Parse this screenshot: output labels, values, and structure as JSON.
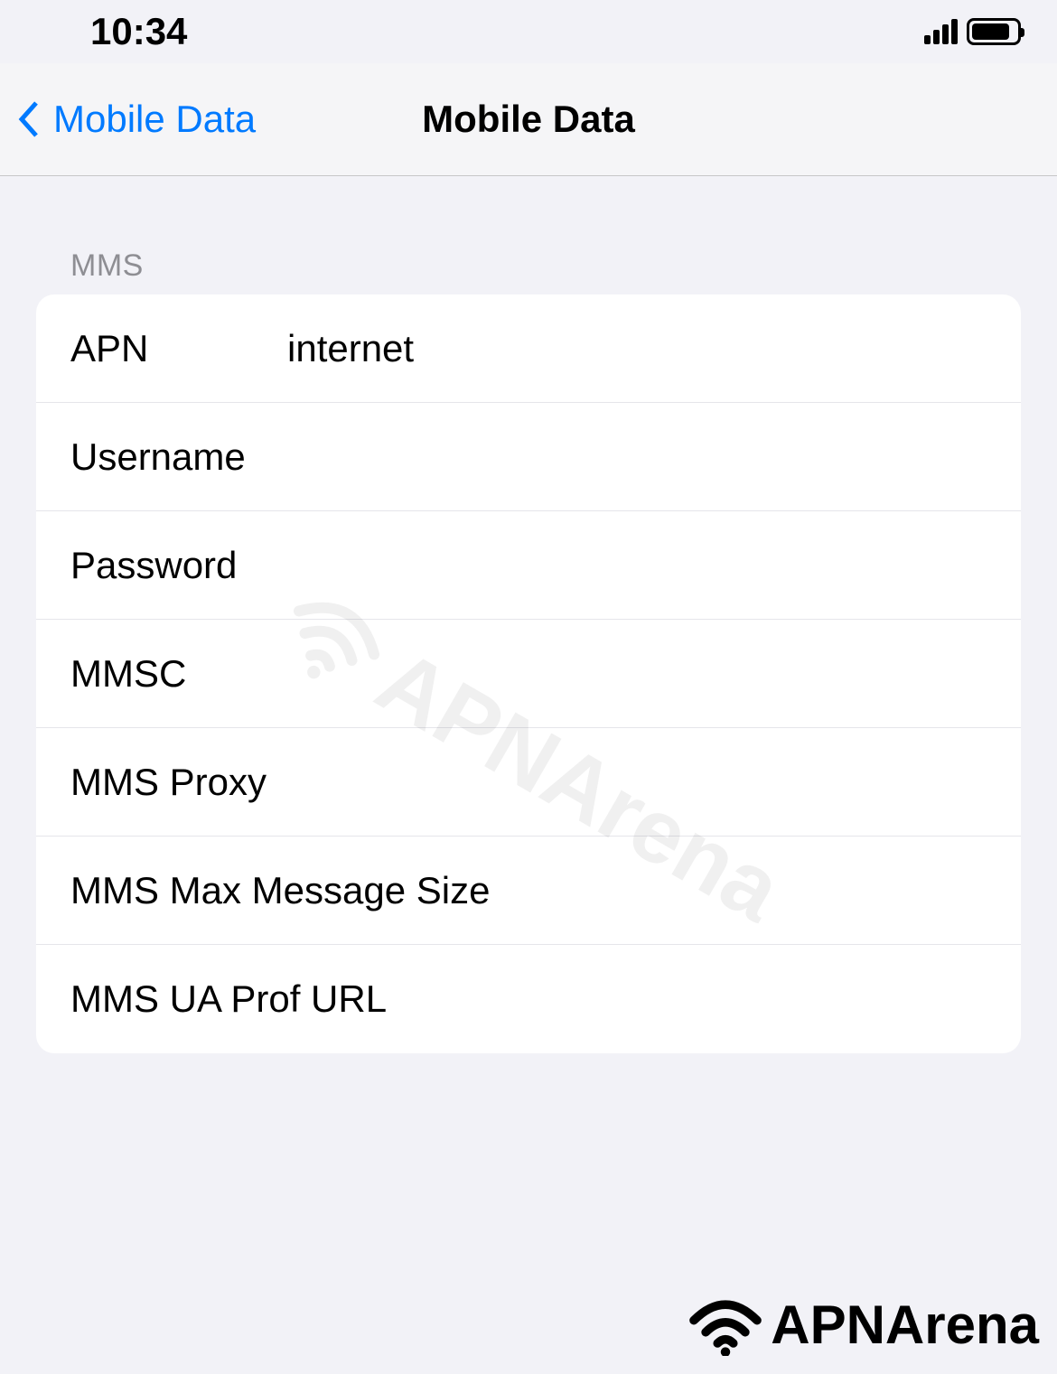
{
  "status_bar": {
    "time": "10:34"
  },
  "nav": {
    "back_label": "Mobile Data",
    "title": "Mobile Data"
  },
  "section": {
    "header": "MMS",
    "rows": [
      {
        "label": "APN",
        "value": "internet"
      },
      {
        "label": "Username",
        "value": ""
      },
      {
        "label": "Password",
        "value": ""
      },
      {
        "label": "MMSC",
        "value": ""
      },
      {
        "label": "MMS Proxy",
        "value": ""
      },
      {
        "label": "MMS Max Message Size",
        "value": ""
      },
      {
        "label": "MMS UA Prof URL",
        "value": ""
      }
    ]
  },
  "watermark": "APNArena",
  "footer_brand": "APNArena"
}
